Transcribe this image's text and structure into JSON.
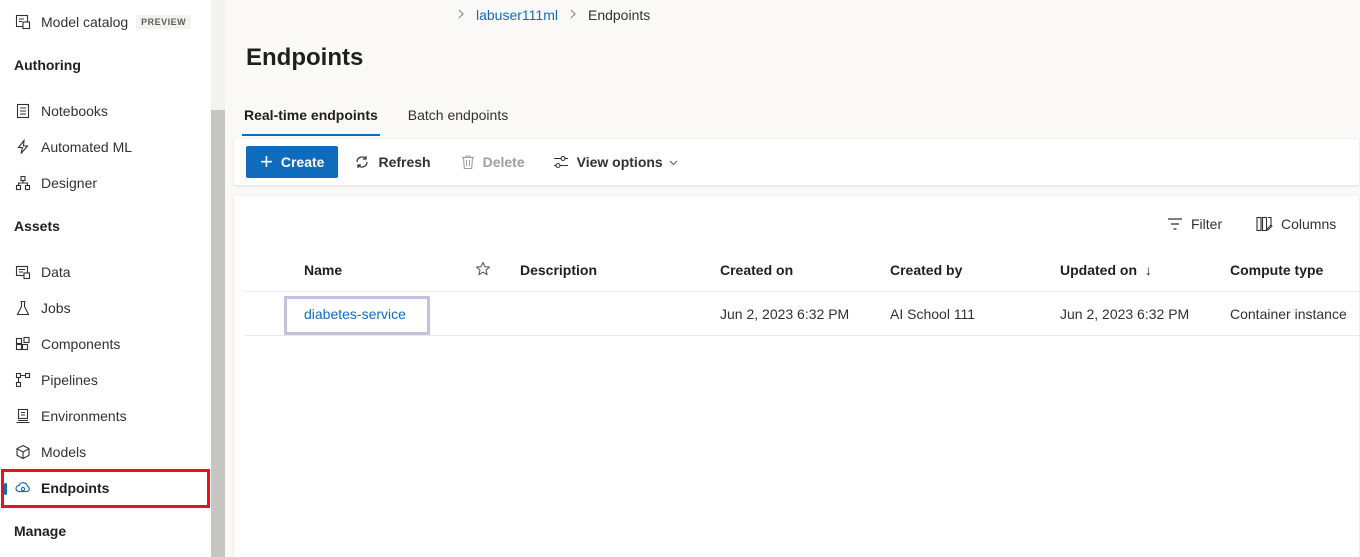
{
  "sidebar": {
    "model_catalog": {
      "label": "Model catalog",
      "badge": "PREVIEW",
      "icon": "model-catalog-icon"
    },
    "sections": {
      "authoring": "Authoring",
      "assets": "Assets",
      "manage": "Manage"
    },
    "authoring_items": [
      {
        "label": "Notebooks",
        "icon": "notebook-icon"
      },
      {
        "label": "Automated ML",
        "icon": "automated-ml-icon"
      },
      {
        "label": "Designer",
        "icon": "designer-icon"
      }
    ],
    "asset_items": [
      {
        "label": "Data",
        "icon": "data-icon"
      },
      {
        "label": "Jobs",
        "icon": "jobs-icon"
      },
      {
        "label": "Components",
        "icon": "components-icon"
      },
      {
        "label": "Pipelines",
        "icon": "pipelines-icon"
      },
      {
        "label": "Environments",
        "icon": "environments-icon"
      },
      {
        "label": "Models",
        "icon": "models-icon"
      },
      {
        "label": "Endpoints",
        "icon": "endpoints-icon",
        "active": true
      }
    ]
  },
  "breadcrumb": {
    "workspace": "labuser111ml",
    "current": "Endpoints"
  },
  "page": {
    "title": "Endpoints"
  },
  "tabs": [
    {
      "label": "Real-time endpoints",
      "active": true
    },
    {
      "label": "Batch endpoints",
      "active": false
    }
  ],
  "toolbar": {
    "create": "Create",
    "refresh": "Refresh",
    "delete": "Delete",
    "view_options": "View options"
  },
  "grid": {
    "filter": "Filter",
    "columns_btn": "Columns",
    "headers": {
      "name": "Name",
      "description": "Description",
      "created_on": "Created on",
      "created_by": "Created by",
      "updated_on": "Updated on",
      "compute_type": "Compute type"
    },
    "sort_indicator": "↓",
    "rows": [
      {
        "name": "diabetes-service",
        "description": "",
        "created_on": "Jun 2, 2023 6:32 PM",
        "created_by": "AI School 111",
        "updated_on": "Jun 2, 2023 6:32 PM",
        "compute_type": "Container instance"
      }
    ]
  },
  "colors": {
    "accent": "#0f6cbd",
    "highlight_red": "#e81123",
    "row_highlight": "#c6c0de"
  }
}
